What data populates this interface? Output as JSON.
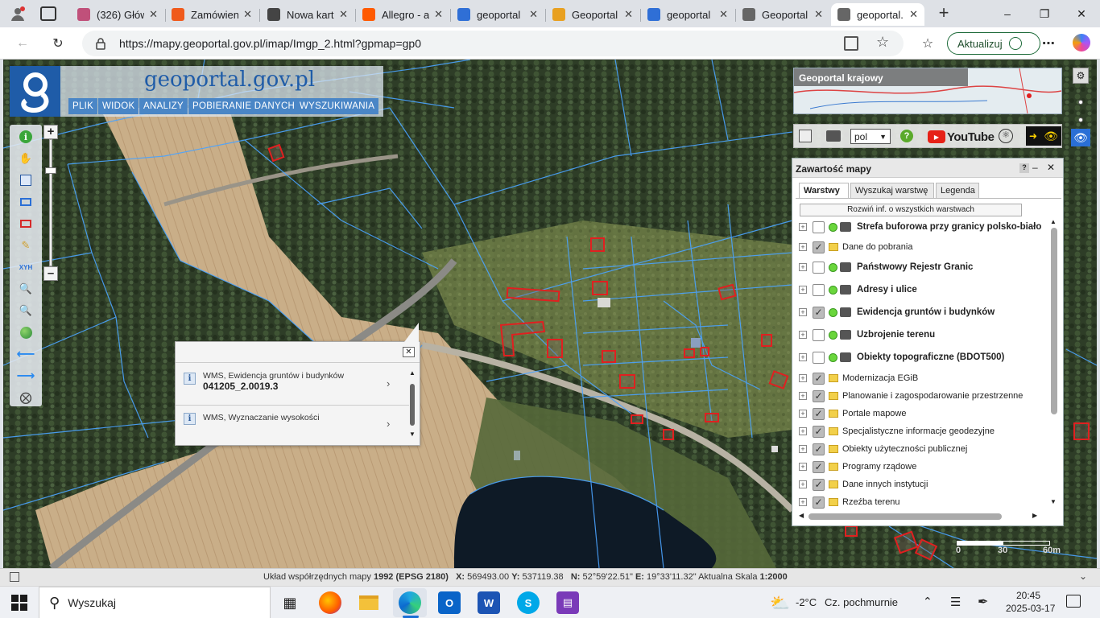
{
  "browser": {
    "tabs": [
      {
        "title": "(326) Głów",
        "icon": "mail-icon",
        "color": "#c0507a"
      },
      {
        "title": "Zamówien",
        "icon": "shop-icon",
        "color": "#f05a1c"
      },
      {
        "title": "Nowa kart",
        "icon": "tab-icon",
        "color": "#444444"
      },
      {
        "title": "Allegro - a",
        "icon": "allegro-icon",
        "color": "#ff5a00"
      },
      {
        "title": "geoportal",
        "icon": "search-icon",
        "color": "#2f6fd6"
      },
      {
        "title": "Geoportal",
        "icon": "geoportal-flag-icon",
        "color": "#e8a020"
      },
      {
        "title": "geoportal",
        "icon": "search-icon",
        "color": "#2f6fd6"
      },
      {
        "title": "Geoportal",
        "icon": "geoportal-icon",
        "color": "#666666"
      },
      {
        "title": "geoportal.",
        "icon": "geoportal-icon",
        "color": "#666666",
        "active": true
      }
    ],
    "url": "https://mapy.geoportal.gov.pl/imap/Imgp_2.html?gpmap=gp0",
    "update_label": "Aktualizuj"
  },
  "geoportal": {
    "logo_text": "geoportal.gov.pl",
    "menu": [
      "PLIK",
      "WIDOK",
      "ANALIZY",
      "POBIERANIE DANYCH",
      "WYSZUKIWANIA"
    ],
    "minimap_title": "Geoportal krajowy",
    "language": "pol",
    "youtube_label": "YouTube"
  },
  "panel": {
    "title": "Zawartość mapy",
    "tabs": [
      "Warstwy",
      "Wyszukaj warstwę",
      "Legenda"
    ],
    "expand_all": "Rozwiń inf. o wszystkich warstwach",
    "layers": [
      {
        "label": "Strefa buforowa przy granicy polsko-biało",
        "checked": false,
        "wms": true,
        "bold": true
      },
      {
        "label": "Dane do pobrania",
        "checked": true,
        "wms": false,
        "bold": false
      },
      {
        "label": "Państwowy Rejestr Granic",
        "checked": false,
        "wms": true,
        "bold": true
      },
      {
        "label": "Adresy i ulice",
        "checked": false,
        "wms": true,
        "bold": true
      },
      {
        "label": "Ewidencja gruntów i budynków",
        "checked": true,
        "wms": true,
        "bold": true
      },
      {
        "label": "Uzbrojenie terenu",
        "checked": false,
        "wms": true,
        "bold": true
      },
      {
        "label": "Obiekty topograficzne (BDOT500)",
        "checked": false,
        "wms": true,
        "bold": true
      },
      {
        "label": "Modernizacja EGiB",
        "checked": true,
        "wms": false,
        "bold": false
      },
      {
        "label": "Planowanie i zagospodarowanie przestrzenne",
        "checked": true,
        "wms": false,
        "bold": false
      },
      {
        "label": "Portale mapowe",
        "checked": true,
        "wms": false,
        "bold": false
      },
      {
        "label": "Specjalistyczne informacje geodezyjne",
        "checked": true,
        "wms": false,
        "bold": false
      },
      {
        "label": "Obiekty użyteczności publicznej",
        "checked": true,
        "wms": false,
        "bold": false
      },
      {
        "label": "Programy rządowe",
        "checked": true,
        "wms": false,
        "bold": false
      },
      {
        "label": "Dane innych instytucji",
        "checked": true,
        "wms": false,
        "bold": false
      },
      {
        "label": "Rzeźba terenu",
        "checked": true,
        "wms": false,
        "bold": false
      }
    ]
  },
  "popup": {
    "items": [
      {
        "source": "WMS, Ewidencja gruntów i budynków",
        "value": "041205_2.0019.3"
      },
      {
        "source": "WMS, Wyznaczanie wysokości",
        "value": ""
      }
    ]
  },
  "scale_labels": [
    "0",
    "30",
    "60m"
  ],
  "status": {
    "crs_label": "Układ współrzędnych mapy",
    "crs_value": "1992 (EPSG 2180)",
    "x_label": "X:",
    "x_value": "569493.00",
    "y_label": "Y:",
    "y_value": "537119.38",
    "n_label": "N:",
    "n_value": "52°59'22.51\"",
    "e_label": "E:",
    "e_value": "19°33'11.32\"",
    "scale_label": "Aktualna Skala",
    "scale_value": "1:2000"
  },
  "taskbar": {
    "search_placeholder": "Wyszukaj",
    "weather_temp": "-2°C",
    "weather_text": "Cz. pochmurnie",
    "time": "20:45",
    "date": "2025-03-17"
  }
}
